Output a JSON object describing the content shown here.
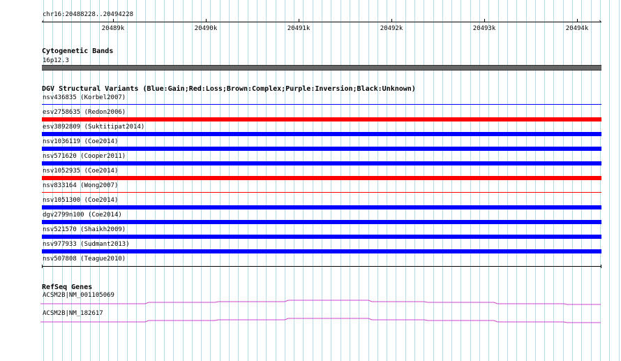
{
  "ruler": {
    "location": "chr16:20488228..20494228",
    "ticks": [
      "20489k",
      "20490k",
      "20491k",
      "20492k",
      "20493k",
      "20494k"
    ]
  },
  "cytoband": {
    "title": "Cytogenetic Bands",
    "band_label": "16p12.3",
    "band_color": "#666666"
  },
  "dgv": {
    "title": "DGV Structural Variants (Blue:Gain;Red:Loss;Brown:Complex;Purple:Inversion;Black:Unknown)",
    "colors": {
      "gain": "#0000ff",
      "loss": "#ff0000"
    },
    "variants": [
      {
        "label": "nsv436835 (Korbel2007)",
        "type": "gain"
      },
      {
        "label": "esv2758635 (Redon2006)",
        "type": "loss"
      },
      {
        "label": "esv3892809 (Suktitipat2014)",
        "type": "gain"
      },
      {
        "label": "nsv1036119 (Coe2014)",
        "type": "gain"
      },
      {
        "label": "nsv571620 (Cooper2011)",
        "type": "gain"
      },
      {
        "label": "nsv1052935 (Coe2014)",
        "type": "loss"
      },
      {
        "label": "nsv833164 (Wong2007)",
        "type": "loss"
      },
      {
        "label": "nsv1051300 (Coe2014)",
        "type": "gain"
      },
      {
        "label": "dgv2799n100 (Coe2014)",
        "type": "gain"
      },
      {
        "label": "nsv521570 (Shaikh2009)",
        "type": "gain"
      },
      {
        "label": "nsv977933 (Sudmant2013)",
        "type": "gain"
      },
      {
        "label": "nsv507808 (Teague2010)",
        "type": "unknown"
      }
    ]
  },
  "refseq": {
    "title": "RefSeq Genes",
    "gene_color": "#cc44cc",
    "genes": [
      {
        "label": "ACSM2B|NM_001105069"
      },
      {
        "label": "ACSM2B|NM_182617"
      }
    ]
  }
}
